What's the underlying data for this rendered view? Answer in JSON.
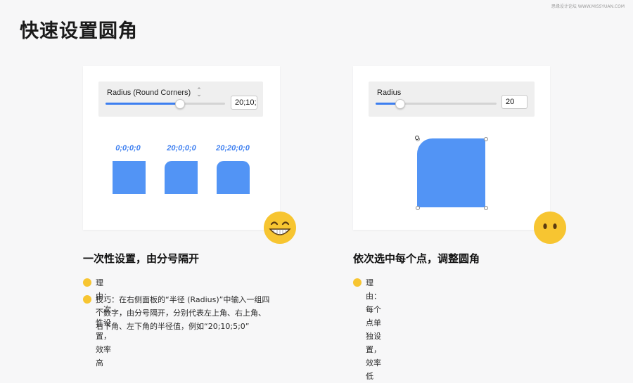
{
  "watermark": "思缘设计论坛 WWW.MISSYUAN.COM",
  "page_title": "快速设置圆角",
  "left_card": {
    "label": "Radius (Round Corners)",
    "value": "20;10;",
    "slider_fraction": 0.62,
    "examples": [
      {
        "label": "0;0;0;0"
      },
      {
        "label": "20;0;0;0"
      },
      {
        "label": "20;20;0;0"
      }
    ]
  },
  "right_card": {
    "label": "Radius",
    "value": "20",
    "slider_fraction": 0.2
  },
  "left_section": {
    "title": "一次性设置，由分号隔开",
    "bullets": [
      "理由：一次性设置，效率高",
      "技巧：在右侧面板的“半径 (Radius)”中输入一组四",
      "个数字，由分号隔开，分别代表左上角、右上角、",
      "右下角、左下角的半径值，例如“20;10;5;0”"
    ]
  },
  "right_section": {
    "title": "依次选中每个点，调整圆角",
    "bullets": [
      "理由：每个点单独设置，效率低"
    ]
  },
  "icons": {
    "grin": "grinning-face-icon",
    "neutral": "face-without-mouth-icon"
  },
  "colors": {
    "accent": "#3d7ff0",
    "shape": "#5294f5",
    "emoji": "#f7c531"
  }
}
